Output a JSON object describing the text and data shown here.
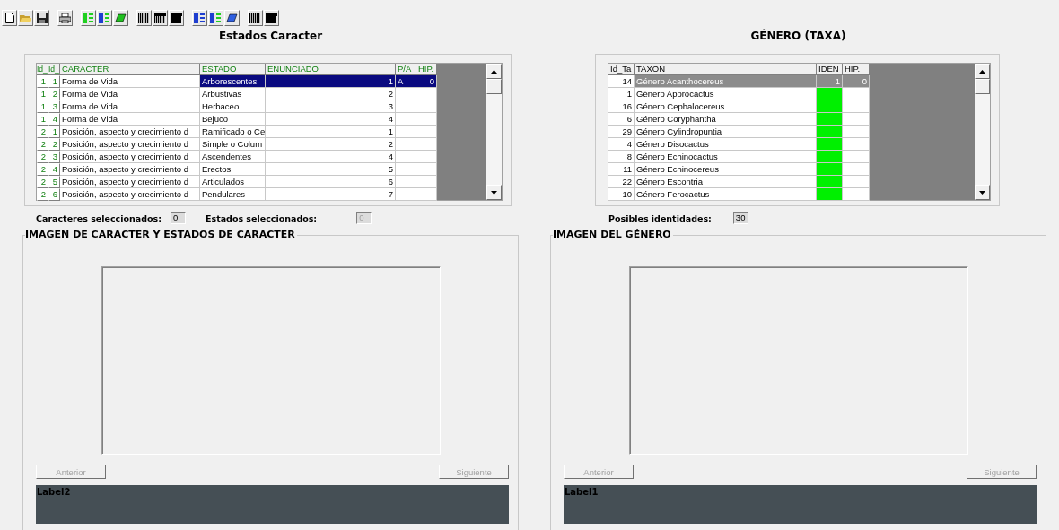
{
  "toolbar": [
    {
      "kind": "new"
    },
    {
      "kind": "open"
    },
    {
      "kind": "save"
    },
    {
      "kind": "gap"
    },
    {
      "kind": "print"
    },
    {
      "kind": "gap"
    },
    {
      "kind": "list-green"
    },
    {
      "kind": "list-mixed-green"
    },
    {
      "kind": "eraser-green"
    },
    {
      "kind": "gap"
    },
    {
      "kind": "bars-light"
    },
    {
      "kind": "bars-mid"
    },
    {
      "kind": "bars-dark"
    },
    {
      "kind": "gap"
    },
    {
      "kind": "list-blue"
    },
    {
      "kind": "list-mixed-blue"
    },
    {
      "kind": "eraser-blue"
    },
    {
      "kind": "gap"
    },
    {
      "kind": "bars-light"
    },
    {
      "kind": "bars-dark"
    }
  ],
  "characters": {
    "title": "Estados Caracter",
    "columns": [
      "Id_",
      "Id_",
      "CARACTER",
      "ESTADO",
      "ENUNCIADO",
      "P/A",
      "HIP."
    ],
    "rows": [
      {
        "id1": "1",
        "id2": "1",
        "caracter": "Forma de Vida",
        "estado": "Arborescentes",
        "enunciado": "1",
        "pa": "A",
        "hip": "0",
        "selected": true
      },
      {
        "id1": "1",
        "id2": "2",
        "caracter": "Forma de Vida",
        "estado": "Arbustivas",
        "enunciado": "2",
        "selected": false
      },
      {
        "id1": "1",
        "id2": "3",
        "caracter": "Forma de Vida",
        "estado": "Herbaceo",
        "enunciado": "3",
        "selected": false
      },
      {
        "id1": "1",
        "id2": "4",
        "caracter": "Forma de Vida",
        "estado": "Bejuco",
        "enunciado": "4",
        "selected": false
      },
      {
        "id1": "2",
        "id2": "1",
        "caracter": "Posición, aspecto y crecimiento d",
        "estado": "Ramificado o Ce",
        "enunciado": "1",
        "selected": false
      },
      {
        "id1": "2",
        "id2": "2",
        "caracter": "Posición, aspecto y crecimiento d",
        "estado": "Simple o Colum",
        "enunciado": "2",
        "selected": false
      },
      {
        "id1": "2",
        "id2": "3",
        "caracter": "Posición, aspecto y crecimiento d",
        "estado": "Ascendentes",
        "enunciado": "4",
        "selected": false
      },
      {
        "id1": "2",
        "id2": "4",
        "caracter": "Posición, aspecto y crecimiento d",
        "estado": "Erectos",
        "enunciado": "5",
        "selected": false
      },
      {
        "id1": "2",
        "id2": "5",
        "caracter": "Posición, aspecto y crecimiento d",
        "estado": "Articulados",
        "enunciado": "6",
        "selected": false
      },
      {
        "id1": "2",
        "id2": "6",
        "caracter": "Posición, aspecto y crecimiento d",
        "estado": "Pendulares",
        "enunciado": "7",
        "selected": false
      }
    ],
    "stats": [
      {
        "label": "Caracteres seleccionados:",
        "value": "0",
        "disabled": false
      },
      {
        "label": "Estados seleccionados:",
        "value": "0",
        "disabled": true
      }
    ],
    "image_group": {
      "title": "IMAGEN DE CARACTER Y ESTADOS DE CARACTER",
      "buttons": [
        {
          "label": "Anterior",
          "disabled": true
        },
        {
          "label": "Siguiente",
          "disabled": true
        }
      ],
      "label": "Label2"
    }
  },
  "genus": {
    "title": "GÉNERO (TAXA)",
    "columns": [
      "Id_Ta",
      "TAXON",
      "IDEN",
      "HIP."
    ],
    "rows": [
      {
        "id": "14",
        "taxon": "Género Acanthocereus",
        "iden": "1",
        "hip": "0",
        "selected": true
      },
      {
        "id": "1",
        "taxon": "Género Aporocactus",
        "selected": false
      },
      {
        "id": "16",
        "taxon": "Género Cephalocereus",
        "selected": false
      },
      {
        "id": "6",
        "taxon": "Género Coryphantha",
        "selected": false
      },
      {
        "id": "29",
        "taxon": "Género Cylindropuntia",
        "selected": false
      },
      {
        "id": "4",
        "taxon": "Género Disocactus",
        "selected": false
      },
      {
        "id": "8",
        "taxon": "Género Echinocactus",
        "selected": false
      },
      {
        "id": "11",
        "taxon": "Género Echinocereus",
        "selected": false
      },
      {
        "id": "22",
        "taxon": "Género Escontria",
        "selected": false
      },
      {
        "id": "10",
        "taxon": "Género Ferocactus",
        "selected": false
      }
    ],
    "stats": [
      {
        "label": "Posibles identidades:",
        "value": "30",
        "disabled": false
      }
    ],
    "image_group": {
      "title": "IMAGEN DEL GÉNERO",
      "buttons": [
        {
          "label": "Anterior",
          "disabled": true
        },
        {
          "label": "Siguiente",
          "disabled": true
        }
      ],
      "label": "Label1"
    }
  }
}
